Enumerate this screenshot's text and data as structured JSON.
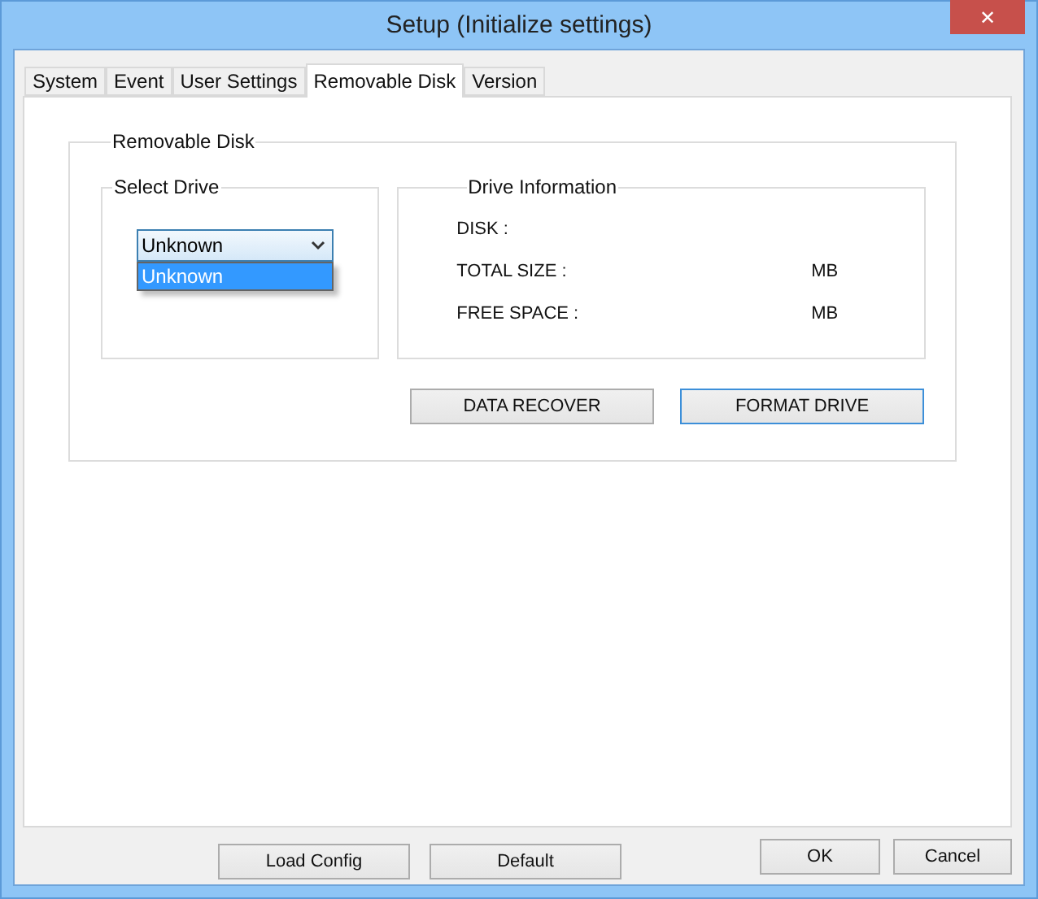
{
  "window": {
    "title": "Setup (Initialize settings)",
    "close": "✕"
  },
  "tabs": [
    {
      "label": "System",
      "selected": false
    },
    {
      "label": "Event",
      "selected": false
    },
    {
      "label": "User Settings",
      "selected": false
    },
    {
      "label": "Removable Disk",
      "selected": true
    },
    {
      "label": "Version",
      "selected": false
    }
  ],
  "group": {
    "title": "Removable Disk",
    "select_drive": {
      "title": "Select Drive",
      "value": "Unknown",
      "expanded": true,
      "options": [
        {
          "label": "Unknown",
          "selected": true
        }
      ]
    },
    "drive_info": {
      "title": "Drive Information",
      "rows": [
        {
          "label": "DISK :",
          "unit": ""
        },
        {
          "label": "TOTAL SIZE :",
          "unit": "MB"
        },
        {
          "label": "FREE SPACE :",
          "unit": "MB"
        }
      ]
    },
    "buttons": [
      {
        "label": "DATA RECOVER",
        "focused": false
      },
      {
        "label": "FORMAT DRIVE",
        "focused": true
      }
    ]
  },
  "footer_left": [
    "Load Config",
    "Default"
  ],
  "footer_right": [
    "OK",
    "Cancel"
  ]
}
